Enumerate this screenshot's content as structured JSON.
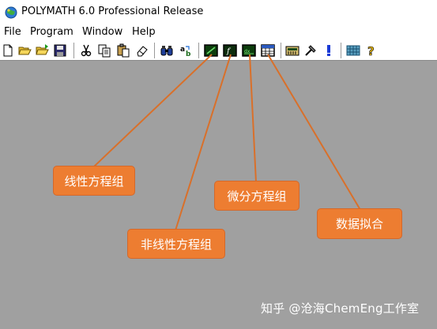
{
  "window": {
    "title": "POLYMATH 6.0 Professional Release",
    "icon": "polymath-globe-icon"
  },
  "menu": [
    "File",
    "Program",
    "Window",
    "Help"
  ],
  "toolbar": {
    "buttons": [
      {
        "name": "new-file-icon"
      },
      {
        "name": "open-folder-icon"
      },
      {
        "name": "open-recent-folder-icon"
      },
      {
        "name": "save-icon"
      },
      {
        "name": "cut-icon"
      },
      {
        "name": "copy-icon"
      },
      {
        "name": "paste-icon"
      },
      {
        "name": "eraser-icon"
      },
      {
        "name": "find-binoculars-icon"
      },
      {
        "name": "replace-icon"
      },
      {
        "name": "linear-equations-icon"
      },
      {
        "name": "nonlinear-equations-icon"
      },
      {
        "name": "differential-equations-icon"
      },
      {
        "name": "data-fitting-icon"
      },
      {
        "name": "calculator-icon"
      },
      {
        "name": "hammer-icon"
      },
      {
        "name": "exclamation-icon"
      },
      {
        "name": "grid-icon"
      },
      {
        "name": "help-question-icon"
      }
    ]
  },
  "callouts": {
    "linear": "线性方程组",
    "nonlinear": "非线性方程组",
    "differential": "微分方程组",
    "regression": "数据拟合"
  },
  "watermark": "知乎 @沧海ChemEng工作室",
  "colors": {
    "callout": "#ed7d31",
    "workspace": "#a0a0a0",
    "arrow": "#d9702a"
  }
}
